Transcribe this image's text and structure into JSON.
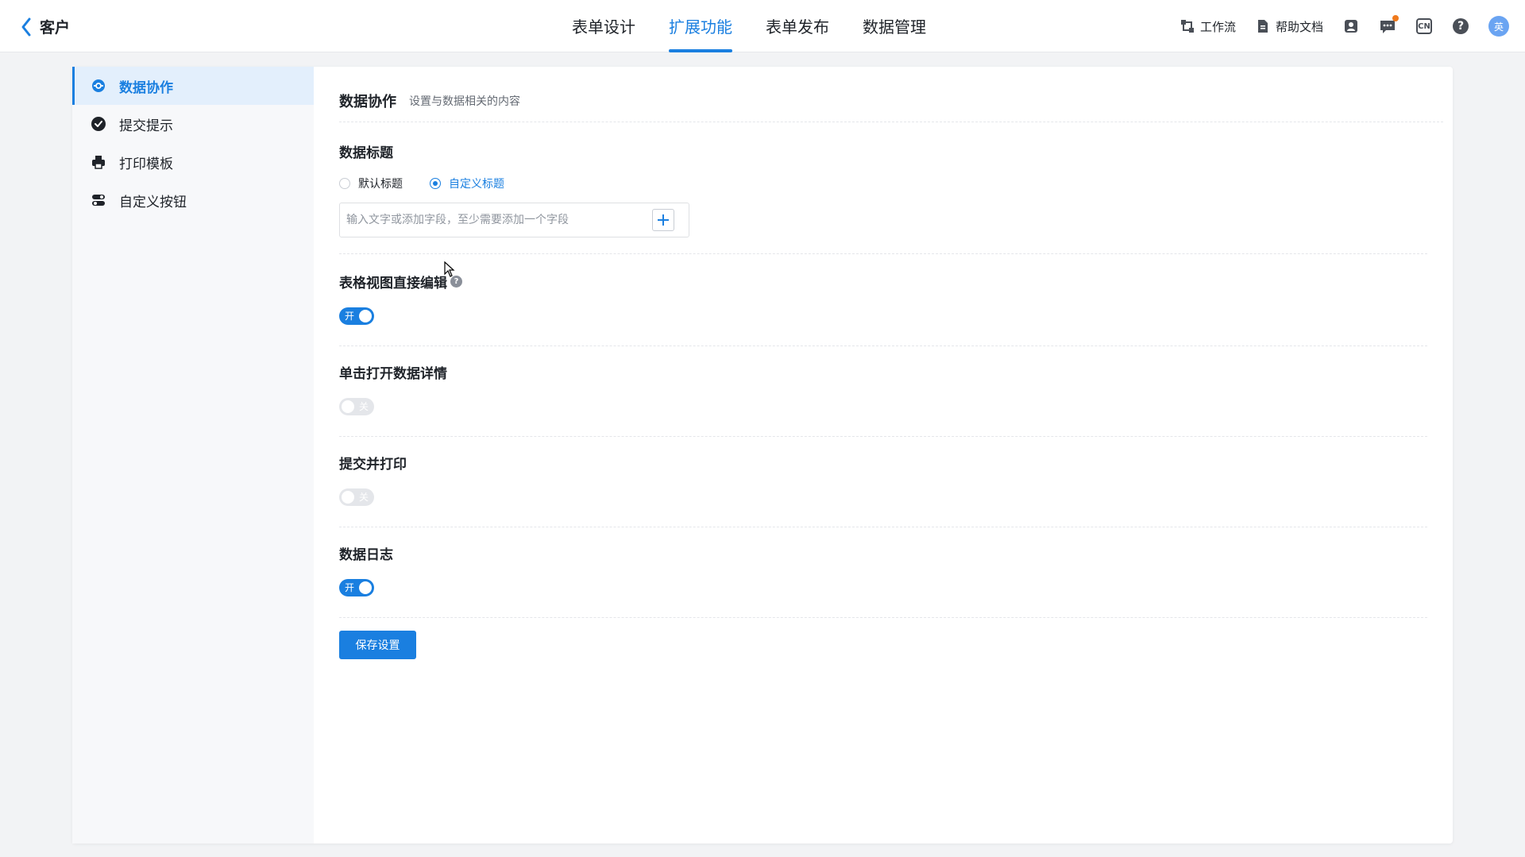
{
  "header": {
    "back_label": "客户",
    "tabs": [
      {
        "label": "表单设计",
        "active": false
      },
      {
        "label": "扩展功能",
        "active": true
      },
      {
        "label": "表单发布",
        "active": false
      },
      {
        "label": "数据管理",
        "active": false
      }
    ],
    "workflow_label": "工作流",
    "help_docs_label": "帮助文档",
    "lang_label": "CN",
    "help_label": "?",
    "avatar_text": "英"
  },
  "sidebar": {
    "items": [
      {
        "label": "数据协作",
        "icon": "collaboration-icon",
        "active": true
      },
      {
        "label": "提交提示",
        "icon": "check-circle-icon",
        "active": false
      },
      {
        "label": "打印模板",
        "icon": "printer-icon",
        "active": false
      },
      {
        "label": "自定义按钮",
        "icon": "toggle-buttons-icon",
        "active": false
      }
    ]
  },
  "content": {
    "title": "数据协作",
    "subtitle": "设置与数据相关的内容",
    "data_title": {
      "label": "数据标题",
      "options": [
        {
          "label": "默认标题",
          "checked": false
        },
        {
          "label": "自定义标题",
          "checked": true
        }
      ],
      "input_value": "",
      "input_placeholder": "输入文字或添加字段，至少需要添加一个字段"
    },
    "grid_edit": {
      "label": "表格视图直接编辑",
      "help": "?",
      "state": "on",
      "switch_text": "开"
    },
    "click_open": {
      "label": "单击打开数据详情",
      "state": "off",
      "switch_text": "关"
    },
    "submit_print": {
      "label": "提交并打印",
      "state": "off",
      "switch_text": "关"
    },
    "data_log": {
      "label": "数据日志",
      "state": "on",
      "switch_text": "开"
    },
    "save_label": "保存设置"
  },
  "colors": {
    "accent": "#1a7fe0",
    "notification_dot": "#f07a1c",
    "switch_off": "#e4e6ea"
  }
}
